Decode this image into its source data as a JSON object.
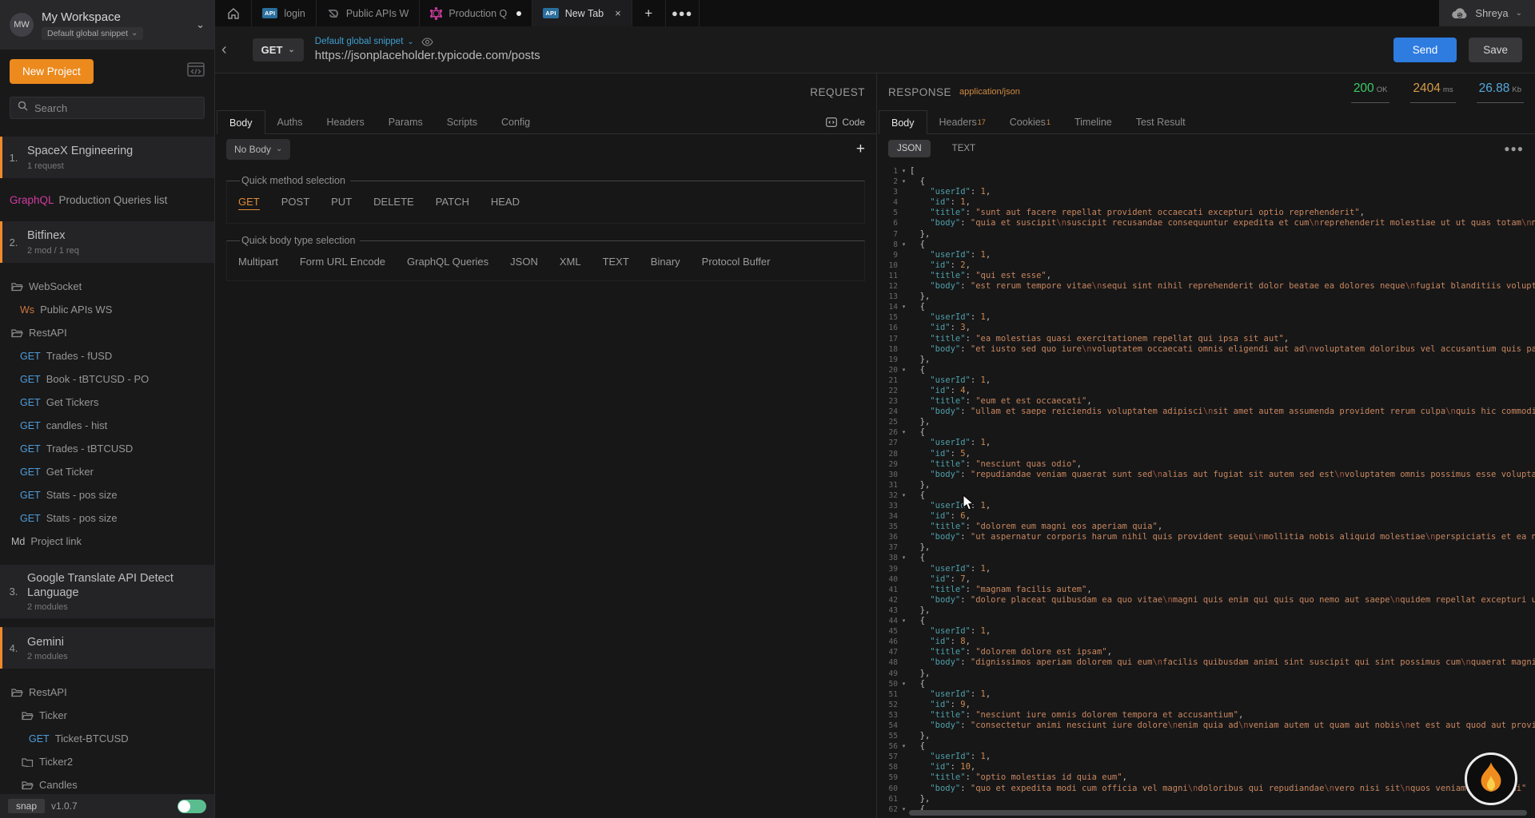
{
  "user": {
    "name": "Shreya"
  },
  "workspace": {
    "initials": "MW",
    "name": "My Workspace",
    "snippet": "Default global snippet"
  },
  "sidebar": {
    "new_project_label": "New Project",
    "search_placeholder": "Search",
    "sections": [
      {
        "items": [
          {
            "t": "project",
            "num": "1.",
            "name": "SpaceX Engineering",
            "sub": "1 request",
            "bar": true
          },
          {
            "t": "link",
            "tag": "GraphQL",
            "tag_color": "#cf3c9f",
            "name": "Production Queries list"
          },
          {
            "t": "project",
            "num": "2.",
            "name": "Bitfinex",
            "sub": "2 mod / 1 req",
            "bar": true
          }
        ]
      },
      {
        "items": [
          {
            "t": "folder",
            "name": "WebSocket",
            "indent": 0,
            "open": true
          },
          {
            "t": "req",
            "method": "Ws",
            "method_color": "#d0763c",
            "name": "Public APIs WS",
            "indent": 1
          },
          {
            "t": "folder",
            "name": "RestAPI",
            "indent": 0,
            "open": true
          },
          {
            "t": "req",
            "method": "GET",
            "method_color": "#4f9cd8",
            "name": "Trades - fUSD",
            "indent": 1
          },
          {
            "t": "req",
            "method": "GET",
            "method_color": "#4f9cd8",
            "name": "Book - tBTCUSD - PO",
            "indent": 1
          },
          {
            "t": "req",
            "method": "GET",
            "method_color": "#4f9cd8",
            "name": "Get Tickers",
            "indent": 1
          },
          {
            "t": "req",
            "method": "GET",
            "method_color": "#4f9cd8",
            "name": "candles - hist",
            "indent": 1
          },
          {
            "t": "req",
            "method": "GET",
            "method_color": "#4f9cd8",
            "name": "Trades - tBTCUSD",
            "indent": 1
          },
          {
            "t": "req",
            "method": "GET",
            "method_color": "#4f9cd8",
            "name": "Get Ticker",
            "indent": 1
          },
          {
            "t": "req",
            "method": "GET",
            "method_color": "#4f9cd8",
            "name": "Stats - pos size",
            "indent": 1
          },
          {
            "t": "req",
            "method": "GET",
            "method_color": "#4f9cd8",
            "name": "Stats - pos size",
            "indent": 1
          },
          {
            "t": "req",
            "method": "Md",
            "method_color": "#b9b9b9",
            "name": "Project link",
            "indent": 0
          }
        ]
      },
      {
        "items": [
          {
            "t": "project",
            "num": "3.",
            "name": "Google Translate API Detect Language",
            "sub": "2 modules",
            "bar": false
          },
          {
            "t": "project",
            "num": "4.",
            "name": "Gemini",
            "sub": "2 modules",
            "bar": true
          }
        ]
      },
      {
        "items": [
          {
            "t": "folder",
            "name": "RestAPI",
            "indent": 0,
            "open": true
          },
          {
            "t": "folder",
            "name": "Ticker",
            "indent": 1,
            "open": true
          },
          {
            "t": "req",
            "method": "GET",
            "method_color": "#4f9cd8",
            "name": "Ticket-BTCUSD",
            "indent": 2
          },
          {
            "t": "folder",
            "name": "Ticker2",
            "indent": 1,
            "open": false
          },
          {
            "t": "folder",
            "name": "Candles",
            "indent": 1,
            "open": true
          }
        ]
      }
    ],
    "footer": {
      "app": "snap",
      "version": "v1.0.7"
    }
  },
  "tabbar": {
    "tabs": [
      {
        "icon": "api",
        "label": "login"
      },
      {
        "icon": "ws",
        "label": "Public APIs W"
      },
      {
        "icon": "graphql",
        "label": "Production Q",
        "dirty": true
      },
      {
        "icon": "api",
        "label": "New Tab",
        "active": true,
        "closable": true
      }
    ]
  },
  "urlbar": {
    "method": "GET",
    "snippet": "Default global snippet",
    "url": "https://jsonplaceholder.typicode.com/posts",
    "send_label": "Send",
    "save_label": "Save"
  },
  "request": {
    "panel_label": "REQUEST",
    "tabs": [
      {
        "label": "Body",
        "active": true
      },
      {
        "label": "Auths"
      },
      {
        "label": "Headers"
      },
      {
        "label": "Params"
      },
      {
        "label": "Scripts"
      },
      {
        "label": "Config"
      }
    ],
    "code_label": "Code",
    "body_dropdown": "No Body",
    "method_fieldset_label": "Quick method selection",
    "methods": [
      "GET",
      "POST",
      "PUT",
      "DELETE",
      "PATCH",
      "HEAD"
    ],
    "active_method": "GET",
    "body_fieldset_label": "Quick body type selection",
    "body_types": [
      "Multipart",
      "Form URL Encode",
      "GraphQL Queries",
      "JSON",
      "XML",
      "TEXT",
      "Binary",
      "Protocol Buffer"
    ]
  },
  "response": {
    "panel_label": "RESPONSE",
    "content_type": "application/json",
    "status": {
      "code": "200",
      "code_suffix": "OK",
      "time": "2404",
      "time_suffix": "ms",
      "size": "26.88",
      "size_suffix": "Kb"
    },
    "tabs": [
      {
        "label": "Body",
        "active": true
      },
      {
        "label": "Headers",
        "sup": "17"
      },
      {
        "label": "Cookies",
        "sup": "1"
      },
      {
        "label": "Timeline"
      },
      {
        "label": "Test Result"
      }
    ],
    "view_tabs": [
      {
        "label": "JSON",
        "active": true
      },
      {
        "label": "TEXT"
      }
    ]
  },
  "response_json": {
    "posts": [
      {
        "userId": 1,
        "id": 1,
        "title": "sunt aut facere repellat provident occaecati excepturi optio reprehenderit",
        "body": "quia et suscipit\\nsuscipit recusandae consequuntur expedita et cum\\nreprehenderit molestiae ut ut quas totam\\nnostrum rerum est autem sunt rem eveniet architecto"
      },
      {
        "userId": 1,
        "id": 2,
        "title": "qui est esse",
        "body": "est rerum tempore vitae\\nsequi sint nihil reprehenderit dolor beatae ea dolores neque\\nfugiat blanditiis voluptate porro vel nihil molestiae ut reiciendis\\nqui aperiam non debitis possimus qui neque nisi nulla"
      },
      {
        "userId": 1,
        "id": 3,
        "title": "ea molestias quasi exercitationem repellat qui ipsa sit aut",
        "body": "et iusto sed quo iure\\nvoluptatem occaecati omnis eligendi aut ad\\nvoluptatem doloribus vel accusantium quis pariatur\\nmolestiae porro eius odio et labore et velit aut"
      },
      {
        "userId": 1,
        "id": 4,
        "title": "eum et est occaecati",
        "body": "ullam et saepe reiciendis voluptatem adipisci\\nsit amet autem assumenda provident rerum culpa\\nquis hic commodi nesciunt rem tenetur doloremque ipsam iure\\nquis sunt voluptatem rerum illo velit"
      },
      {
        "userId": 1,
        "id": 5,
        "title": "nesciunt quas odio",
        "body": "repudiandae veniam quaerat sunt sed\\nalias aut fugiat sit autem sed est\\nvoluptatem omnis possimus esse voluptatibus quis\\nest aut tenetur dolor neque"
      },
      {
        "userId": 1,
        "id": 6,
        "title": "dolorem eum magni eos aperiam quia",
        "body": "ut aspernatur corporis harum nihil quis provident sequi\\nmollitia nobis aliquid molestiae\\nperspiciatis et ea nemo ab reprehenderit accusantium quas\\nvoluptate dolores velit et doloremque molestiae"
      },
      {
        "userId": 1,
        "id": 7,
        "title": "magnam facilis autem",
        "body": "dolore placeat quibusdam ea quo vitae\\nmagni quis enim qui quis quo nemo aut saepe\\nquidem repellat excepturi ut quia\\nsunt ut sequi eos ea sed quas"
      },
      {
        "userId": 1,
        "id": 8,
        "title": "dolorem dolore est ipsam",
        "body": "dignissimos aperiam dolorem qui eum\\nfacilis quibusdam animi sint suscipit qui sint possimus cum\\nquaerat magni maiores excepturi\\nipsam ut commodi dolor voluptatum modi aut vitae"
      },
      {
        "userId": 1,
        "id": 9,
        "title": "nesciunt iure omnis dolorem tempora et accusantium",
        "body": "consectetur animi nesciunt iure dolore\\nenim quia ad\\nveniam autem ut quam aut nobis\\net est aut quod aut provident voluptas autem voluptas"
      },
      {
        "userId": 1,
        "id": 10,
        "title": "optio molestias id quia eum",
        "body": "quo et expedita modi cum officia vel magni\\ndoloribus qui repudiandae\\nvero nisi sit\\nquos veniam quod sequi"
      }
    ]
  }
}
